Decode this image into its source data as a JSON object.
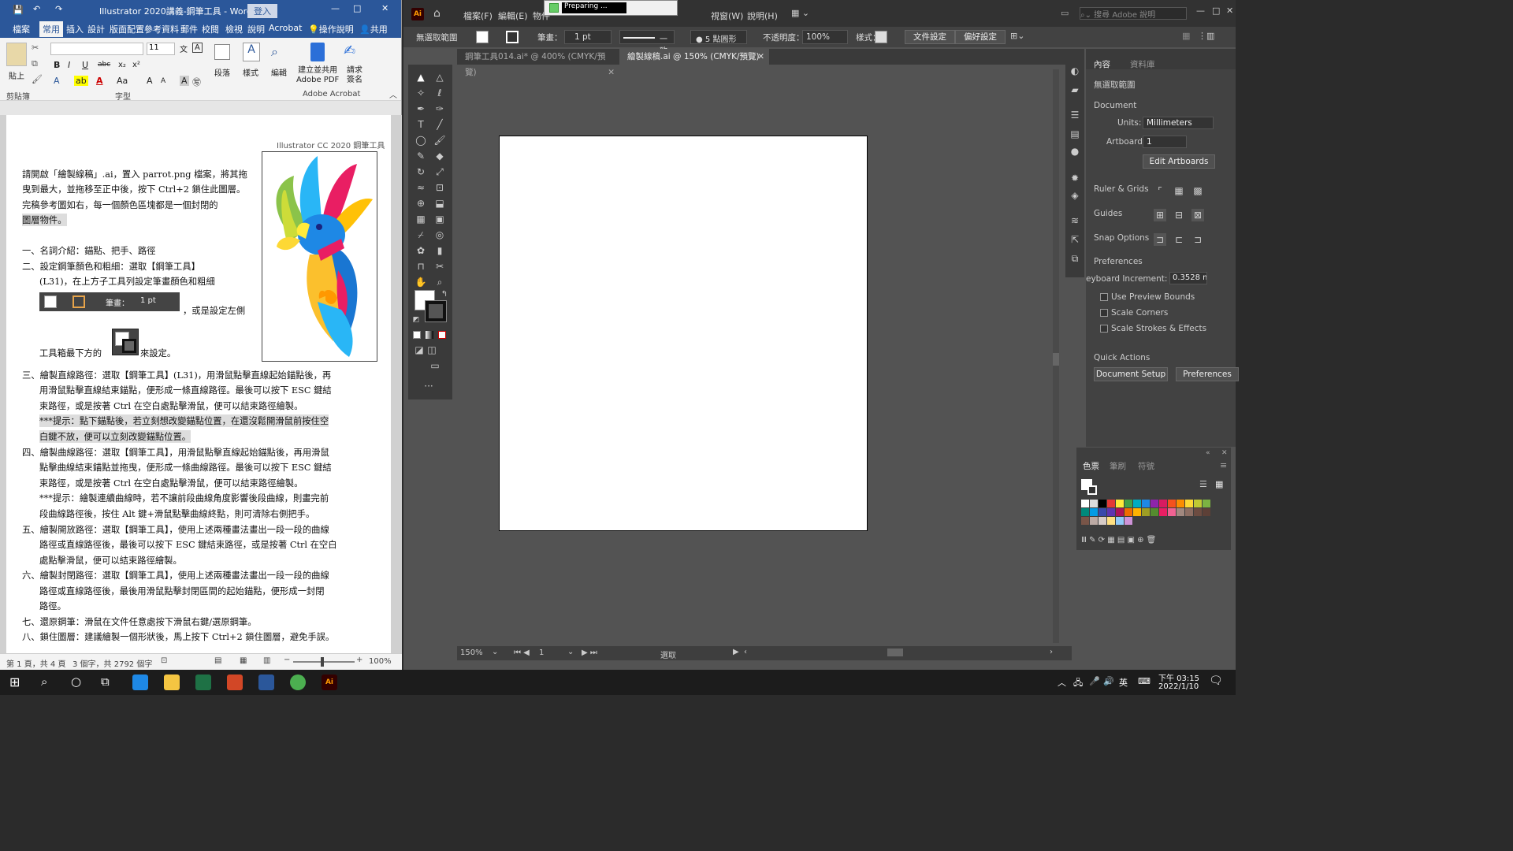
{
  "word": {
    "title": "Illustrator 2020講義-鋼筆工具 - Word",
    "login": "登入",
    "tabs": [
      "檔案",
      "常用",
      "插入",
      "設計",
      "版面配置",
      "參考資料",
      "郵件",
      "校閱",
      "檢視",
      "說明",
      "Acrobat",
      "操作說明",
      "共用"
    ],
    "font_size": "11",
    "ribbon": {
      "paste": "貼上",
      "paragraph": "段落",
      "styles": "樣式",
      "editing": "編輯",
      "create_pdf": "建立並共用\nAdobe PDF",
      "request_sign": "請求\n簽名",
      "clipboard": "剪貼簿",
      "font": "字型",
      "acrobat": "Adobe Acrobat"
    },
    "doc": {
      "header": "Illustrator CC 2020 鋼筆工具",
      "lines": [
        "請開啟「繪製線稿」.ai，置入 parrot.png 檔案，將其拖",
        "曳到最大，並拖移至正中後，按下 Ctrl+2 鎖住此圖層。",
        "完稿參考圖如右，每一個顏色區塊都是一個封閉的",
        "圖層物件。",
        "一、名詞介紹：錨點、把手、路徑",
        "二、設定鋼筆顏色和粗細：選取【鋼筆工具】",
        "(L31)，在上方子工具列設定筆畫顏色和粗細",
        "，或是設定左側",
        "工具箱最下方的",
        "來設定。",
        "三、繪製直線路徑：選取【鋼筆工具】(L31)，用滑鼠點擊直線起始錨點後，再",
        "用滑鼠點擊直線結束錨點，便形成一條直線路徑。最後可以按下 ESC 鍵結",
        "束路徑，或是按著 Ctrl 在空白處點擊滑鼠，便可以結束路徑繪製。",
        "***提示：點下錨點後，若立刻想改變錨點位置，在還沒鬆開滑鼠前按住空",
        "白鍵不放，便可以立刻改變錨點位置。",
        "四、繪製曲線路徑：選取【鋼筆工具】，用滑鼠點擊直線起始錨點後，再用滑鼠",
        "點擊曲線結束錨點並拖曳，便形成一條曲線路徑。最後可以按下 ESC 鍵結",
        "束路徑，或是按著 Ctrl 在空白處點擊滑鼠，便可以結束路徑繪製。",
        "***提示：繪製連續曲線時，若不讓前段曲線角度影響後段曲線，則畫完前",
        "段曲線路徑後，按住 Alt 鍵+滑鼠點擊曲線終點，則可清除右側把手。",
        "五、繪製開放路徑：選取【鋼筆工具】，使用上述兩種畫法畫出一段一段的曲線",
        "路徑或直線路徑後，最後可以按下 ESC 鍵結束路徑，或是按著 Ctrl 在空白",
        "處點擊滑鼠，便可以結束路徑繪製。",
        "六、繪製封閉路徑：選取【鋼筆工具】，使用上述兩種畫法畫出一段一段的曲線",
        "路徑或直線路徑後，最後用滑鼠點擊封閉區間的起始錨點，便形成一封閉",
        "路徑。",
        "七、還原鋼筆：滑鼠在文件任意處按下滑鼠右鍵/選原鋼筆。",
        "八、鎖住圖層：建議繪製一個形狀後，馬上按下 Ctrl+2 鎖住圖層，避免手誤。"
      ],
      "stroke_label": "筆畫：",
      "stroke_value": "1 pt"
    },
    "status": {
      "page": "第 1 頁，共 4 頁",
      "words": "3 個字，共 2792 個字",
      "zoom": "100%"
    }
  },
  "ai": {
    "menu": [
      "檔案(F)",
      "編輯(E)",
      "物件",
      "視窗(W)",
      "說明(H)"
    ],
    "preparing": "Preparing ...",
    "search_placeholder": "搜尋 Adobe 說明",
    "ctrl": {
      "selection": "無選取範圍",
      "stroke_label": "筆畫：",
      "stroke_value": "1 pt",
      "stroke_style": "一致",
      "brush": "5 點圓形",
      "opacity_label": "不透明度：",
      "opacity_value": "100%",
      "style_label": "樣式：",
      "doc_setup": "文件設定",
      "prefs": "偏好設定"
    },
    "tabs": [
      {
        "label": "鋼筆工具014.ai* @ 400% (CMYK/預覽)"
      },
      {
        "label": "繪製線稿.ai @ 150% (CMYK/預覽)"
      }
    ],
    "panel": {
      "tab1": "內容",
      "tab2": "資料庫",
      "no_selection": "無選取範圍",
      "document": "Document",
      "units_label": "Units:",
      "units_value": "Millimeters",
      "artboard_label": "Artboard:",
      "artboard_value": "1",
      "edit_artboards": "Edit Artboards",
      "ruler_grids": "Ruler & Grids",
      "guides": "Guides",
      "snap": "Snap Options",
      "preferences": "Preferences",
      "kb_label": "eyboard Increment:",
      "kb_value": "0.3528 m",
      "use_preview": "Use Preview Bounds",
      "scale_corners": "Scale Corners",
      "scale_strokes": "Scale Strokes & Effects",
      "quick_actions": "Quick Actions",
      "doc_setup_btn": "Document Setup",
      "prefs_btn": "Preferences"
    },
    "color_panel": {
      "tab1": "色票",
      "tab2": "筆刷",
      "tab3": "符號"
    },
    "bottom": {
      "zoom": "150%",
      "artboard": "1",
      "mode": "選取"
    }
  },
  "taskbar": {
    "time": "下午 03:15",
    "date": "2022/1/10",
    "lang": "英"
  }
}
